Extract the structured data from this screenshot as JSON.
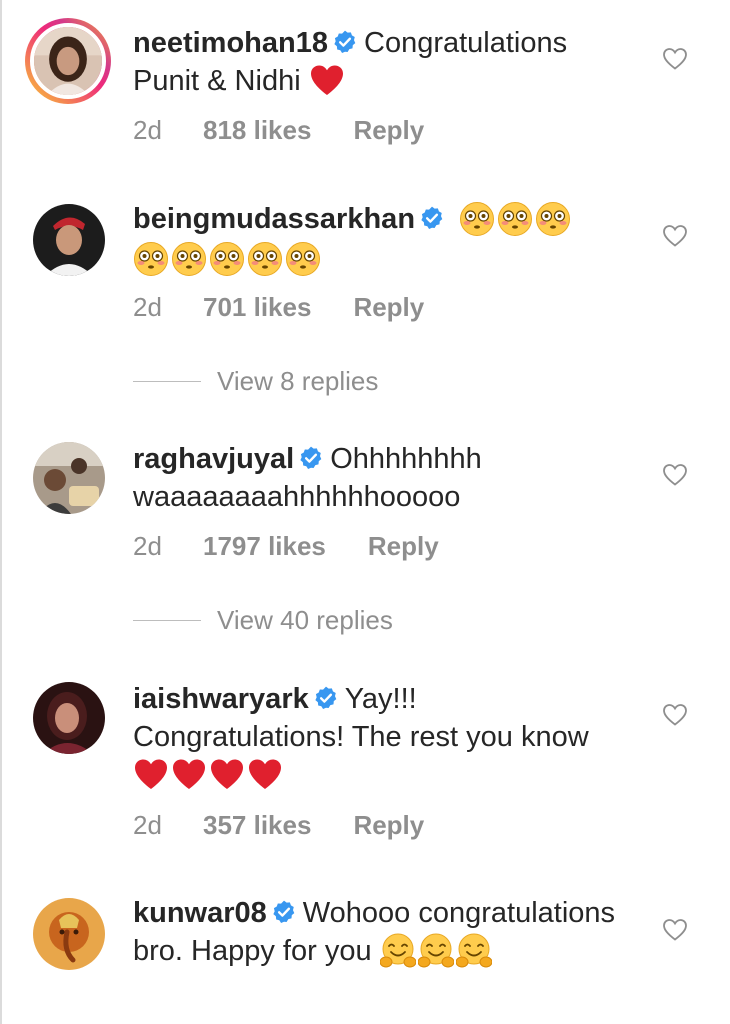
{
  "comments": [
    {
      "username": "neetimohan18",
      "text": "Congratulations Punit & Nidhi",
      "emojis": [
        "red-heart"
      ],
      "time": "2d",
      "likes": "818 likes",
      "reply": "Reply",
      "has_story_ring": true
    },
    {
      "username": "beingmudassarkhan",
      "text": "",
      "emojis": [
        "flushed-face",
        "flushed-face",
        "flushed-face",
        "flushed-face",
        "flushed-face",
        "flushed-face",
        "flushed-face",
        "flushed-face"
      ],
      "time": "2d",
      "likes": "701 likes",
      "reply": "Reply",
      "view_replies": "View 8 replies"
    },
    {
      "username": "raghavjuyal",
      "text": "Ohhhhhhhh waaaaaaaahhhhhhooooo",
      "emojis": [],
      "time": "2d",
      "likes": "1797 likes",
      "reply": "Reply",
      "view_replies": "View 40 replies"
    },
    {
      "username": "iaishwaryark",
      "text": "Yay!!! Congratulations! The rest you know",
      "emojis": [
        "red-heart",
        "red-heart",
        "red-heart",
        "red-heart"
      ],
      "time": "2d",
      "likes": "357 likes",
      "reply": "Reply"
    },
    {
      "username": "kunwar08",
      "text": "Wohooo congratulations bro. Happy for you",
      "emojis": [
        "hugging-face",
        "hugging-face",
        "hugging-face"
      ]
    }
  ],
  "colors": {
    "text": "#262626",
    "secondary": "#8e8e8e",
    "verified": "#3897f0",
    "heart": "#e0202e"
  }
}
